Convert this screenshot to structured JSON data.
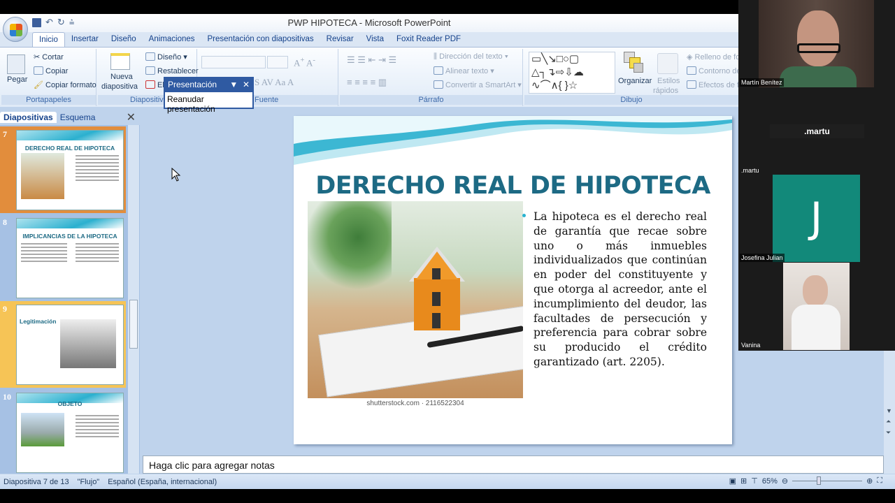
{
  "window": {
    "title": "PWP HIPOTECA - Microsoft PowerPoint"
  },
  "ribbon_tabs": [
    "Inicio",
    "Insertar",
    "Diseño",
    "Animaciones",
    "Presentación con diapositivas",
    "Revisar",
    "Vista",
    "Foxit Reader PDF"
  ],
  "ribbon": {
    "clipboard": {
      "paste": "Pegar",
      "cut": "Cortar",
      "copy": "Copiar",
      "format_painter": "Copiar formato",
      "label": "Portapapeles"
    },
    "slides": {
      "new_slide_1": "Nueva",
      "new_slide_2": "diapositiva",
      "layout": "Diseño",
      "reset": "Restablecer",
      "delete": "El",
      "label": "Diapositivas"
    },
    "font": {
      "label": "Fuente"
    },
    "paragraph": {
      "text_direction": "Dirección del texto",
      "align_text": "Alinear texto",
      "smartart": "Convertir a SmartArt",
      "label": "Párrafo"
    },
    "drawing": {
      "arrange": "Organizar",
      "quick_styles_1": "Estilos",
      "quick_styles_2": "rápidos",
      "fill": "Relleno de fo",
      "outline": "Contorno de",
      "effects": "Efectos de fo",
      "label": "Dibujo"
    }
  },
  "presentation_popup": {
    "title": "Presentación",
    "item": "Reanudar presentación"
  },
  "left_panel": {
    "tabs": [
      "Diapositivas",
      "Esquema"
    ],
    "thumbnails": [
      {
        "num": "7",
        "title": "DERECHO REAL DE HIPOTECA"
      },
      {
        "num": "8",
        "title": "IMPLICANCIAS DE LA HIPOTECA"
      },
      {
        "num": "9",
        "title": "Legitimación"
      },
      {
        "num": "10",
        "title": "OBJETO"
      }
    ]
  },
  "slide": {
    "title": "DERECHO REAL DE HIPOTECA",
    "image_caption": "shutterstock.com · 2116522304",
    "body": "La hipoteca es el derecho real de garantía que recae sobre uno o más inmuebles individualizados que continúan en poder del constituyente y que otorga al acreedor, ante el incumplimiento del deudor, las facultades de persecución y preferencia para cobrar sobre su producido el crédito garantizado (art. 2205)."
  },
  "notes": {
    "placeholder": "Haga clic para agregar notas"
  },
  "status": {
    "slide": "Diapositiva 7 de 13",
    "theme": "\"Flujo\"",
    "language": "Español (España, internacional)",
    "zoom": "65%"
  },
  "meeting": {
    "participants": [
      {
        "name": "Martín Benítez"
      },
      {
        "name": ".martu",
        "banner": ".martu"
      },
      {
        "name": "Josefina Julian",
        "initial": "J",
        "color": "#12897a"
      },
      {
        "name": "Vanina"
      }
    ]
  }
}
